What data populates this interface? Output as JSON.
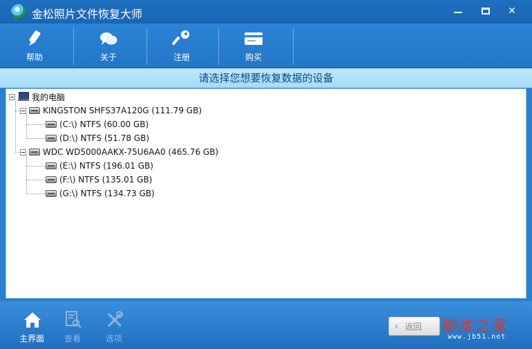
{
  "window": {
    "title": "金松照片文件恢复大师",
    "controls": {
      "minimize": "minimize-icon",
      "maximize": "maximize-icon",
      "close": "✕"
    }
  },
  "toolbar": {
    "items": [
      {
        "label": "帮助",
        "icon": "pencil-icon"
      },
      {
        "label": "关于",
        "icon": "chat-bubbles-icon"
      },
      {
        "label": "注册",
        "icon": "key-icon"
      },
      {
        "label": "购买",
        "icon": "card-icon"
      }
    ]
  },
  "heading": "请选择您想要恢复数据的设备",
  "tree": {
    "root": {
      "label": "我的电脑",
      "icon": "computer-icon"
    },
    "disks": [
      {
        "label": "KINGSTON SHFS37A120G (111.79 GB)",
        "icon": "hard-disk-icon",
        "partitions": [
          {
            "label": "(C:\\) NTFS (60.00 GB)"
          },
          {
            "label": "(D:\\) NTFS (51.78 GB)"
          }
        ]
      },
      {
        "label": "WDC WD5000AAKX-75U6AA0 (465.76 GB)",
        "icon": "hard-disk-icon",
        "partitions": [
          {
            "label": "(E:\\) NTFS (196.01 GB)"
          },
          {
            "label": "(F:\\) NTFS (135.01 GB)"
          },
          {
            "label": "(G:\\) NTFS (134.73 GB)"
          }
        ]
      }
    ]
  },
  "bottom": {
    "tabs": [
      {
        "label": "主界面",
        "icon": "home-icon",
        "enabled": true
      },
      {
        "label": "查看",
        "icon": "document-search-icon",
        "enabled": false
      },
      {
        "label": "选项",
        "icon": "tools-icon",
        "enabled": false
      }
    ],
    "back_label": "返回",
    "watermark": {
      "main": "脚本之家",
      "url": "www.jb51.net"
    }
  },
  "colors": {
    "titlebar": "#1a66b4",
    "heading_bg": "#a6dcf6",
    "heading_text": "#0b4a8a",
    "watermark": "#d33a2c"
  }
}
